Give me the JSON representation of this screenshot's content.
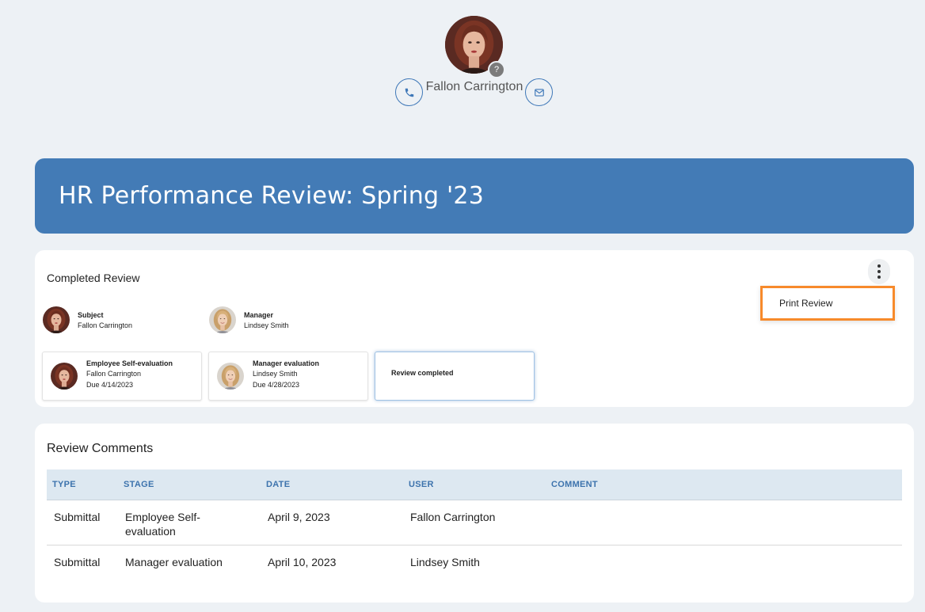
{
  "profile": {
    "name": "Fallon Carrington",
    "help_badge": "?",
    "phone_icon": "phone-icon",
    "mail_icon": "mail-icon"
  },
  "banner": {
    "title": "HR Performance Review: Spring '23"
  },
  "review": {
    "title": "Completed Review",
    "menu": {
      "print_label": "Print Review"
    },
    "subject": {
      "role": "Subject",
      "name": "Fallon Carrington"
    },
    "manager": {
      "role": "Manager",
      "name": "Lindsey Smith"
    },
    "stages": [
      {
        "title": "Employee Self-evaluation",
        "name": "Fallon Carrington",
        "due": "Due 4/14/2023"
      },
      {
        "title": "Manager evaluation",
        "name": "Lindsey Smith",
        "due": "Due 4/28/2023"
      },
      {
        "title": "Review completed"
      }
    ]
  },
  "comments": {
    "title": "Review Comments",
    "columns": [
      "TYPE",
      "STAGE",
      "DATE",
      "USER",
      "COMMENT"
    ],
    "rows": [
      {
        "type": "Submittal",
        "stage": "Employee Self-evaluation",
        "date": "April 9, 2023",
        "user": "Fallon Carrington",
        "comment": ""
      },
      {
        "type": "Submittal",
        "stage": "Manager evaluation",
        "date": "April 10, 2023",
        "user": "Lindsey Smith",
        "comment": ""
      }
    ]
  },
  "colors": {
    "accent": "#437bb6",
    "background": "#edf1f5",
    "highlight": "#f78a2b",
    "table_header": "#dde8f1"
  }
}
